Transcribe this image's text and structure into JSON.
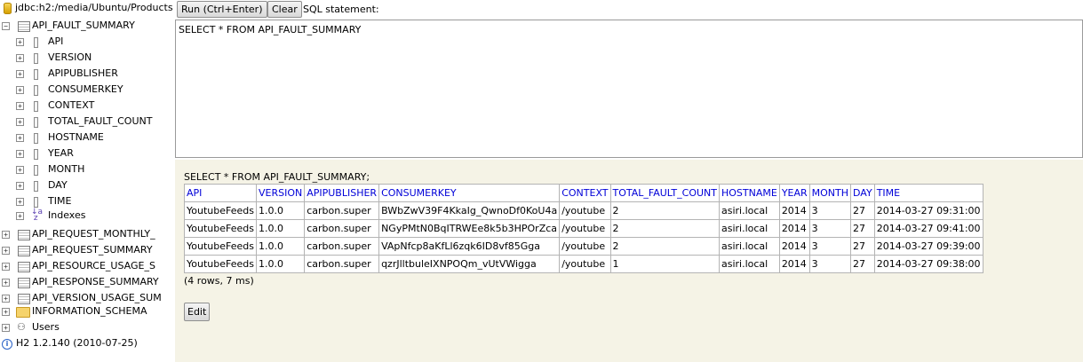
{
  "tree": {
    "connection": "jdbc:h2:/media/Ubuntu/Products",
    "table_main": "API_FAULT_SUMMARY",
    "columns": [
      "API",
      "VERSION",
      "APIPUBLISHER",
      "CONSUMERKEY",
      "CONTEXT",
      "TOTAL_FAULT_COUNT",
      "HOSTNAME",
      "YEAR",
      "MONTH",
      "DAY",
      "TIME"
    ],
    "indexes": "Indexes",
    "tables": [
      "API_REQUEST_MONTHLY_",
      "API_REQUEST_SUMMARY",
      "API_RESOURCE_USAGE_S",
      "API_RESPONSE_SUMMARY",
      "API_VERSION_USAGE_SUM"
    ],
    "schema": "INFORMATION_SCHEMA",
    "users": "Users",
    "version": "H2 1.2.140 (2010-07-25)"
  },
  "toolbar": {
    "run_label": "Run (Ctrl+Enter)",
    "clear_label": "Clear",
    "sql_label": "SQL statement:"
  },
  "editor": {
    "sql": "SELECT * FROM API_FAULT_SUMMARY"
  },
  "result": {
    "statement": "SELECT * FROM API_FAULT_SUMMARY;",
    "headers": [
      "API",
      "VERSION",
      "APIPUBLISHER",
      "CONSUMERKEY",
      "CONTEXT",
      "TOTAL_FAULT_COUNT",
      "HOSTNAME",
      "YEAR",
      "MONTH",
      "DAY",
      "TIME"
    ],
    "rows": [
      [
        "YoutubeFeeds",
        "1.0.0",
        "carbon.super",
        "BWbZwV39F4KkaIg_QwnoDf0KoU4a",
        "/youtube",
        "2",
        "asiri.local",
        "2014",
        "3",
        "27",
        "2014-03-27 09:31:00"
      ],
      [
        "YoutubeFeeds",
        "1.0.0",
        "carbon.super",
        "NGyPMtN0BqITRWEe8k5b3HPOrZca",
        "/youtube",
        "2",
        "asiri.local",
        "2014",
        "3",
        "27",
        "2014-03-27 09:41:00"
      ],
      [
        "YoutubeFeeds",
        "1.0.0",
        "carbon.super",
        "VApNfcp8aKfLl6zqk6ID8vf85Gga",
        "/youtube",
        "2",
        "asiri.local",
        "2014",
        "3",
        "27",
        "2014-03-27 09:39:00"
      ],
      [
        "YoutubeFeeds",
        "1.0.0",
        "carbon.super",
        "qzrJlltbuleIXNPOQm_vUtVWigga",
        "/youtube",
        "1",
        "asiri.local",
        "2014",
        "3",
        "27",
        "2014-03-27 09:38:00"
      ]
    ],
    "count": "(4 rows, 7 ms)",
    "edit_label": "Edit"
  },
  "colors": {
    "header_text": "#0000d8",
    "result_bg": "#f5f3e6"
  }
}
